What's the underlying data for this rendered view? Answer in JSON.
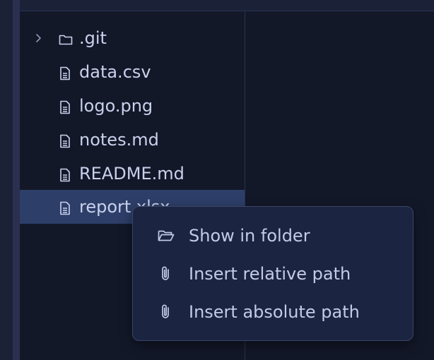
{
  "explorer": {
    "items": [
      {
        "label": ".git",
        "kind": "folder",
        "icon": "folder-icon",
        "expandable": true
      },
      {
        "label": "data.csv",
        "kind": "file",
        "icon": "file-icon"
      },
      {
        "label": "logo.png",
        "kind": "file",
        "icon": "file-icon"
      },
      {
        "label": "notes.md",
        "kind": "file",
        "icon": "file-icon"
      },
      {
        "label": "README.md",
        "kind": "file",
        "icon": "file-icon"
      },
      {
        "label": "report.xlsx",
        "kind": "file",
        "icon": "file-icon",
        "selected": true
      }
    ]
  },
  "context_menu": {
    "items": [
      {
        "label": "Show in folder",
        "icon": "folder-open-icon"
      },
      {
        "label": "Insert relative path",
        "icon": "paperclip-icon"
      },
      {
        "label": "Insert absolute path",
        "icon": "paperclip-icon"
      }
    ]
  },
  "colors": {
    "background": "#131829",
    "selected_row": "#2d3e69",
    "menu_background": "#1b2440",
    "text": "#c9d1ec"
  }
}
